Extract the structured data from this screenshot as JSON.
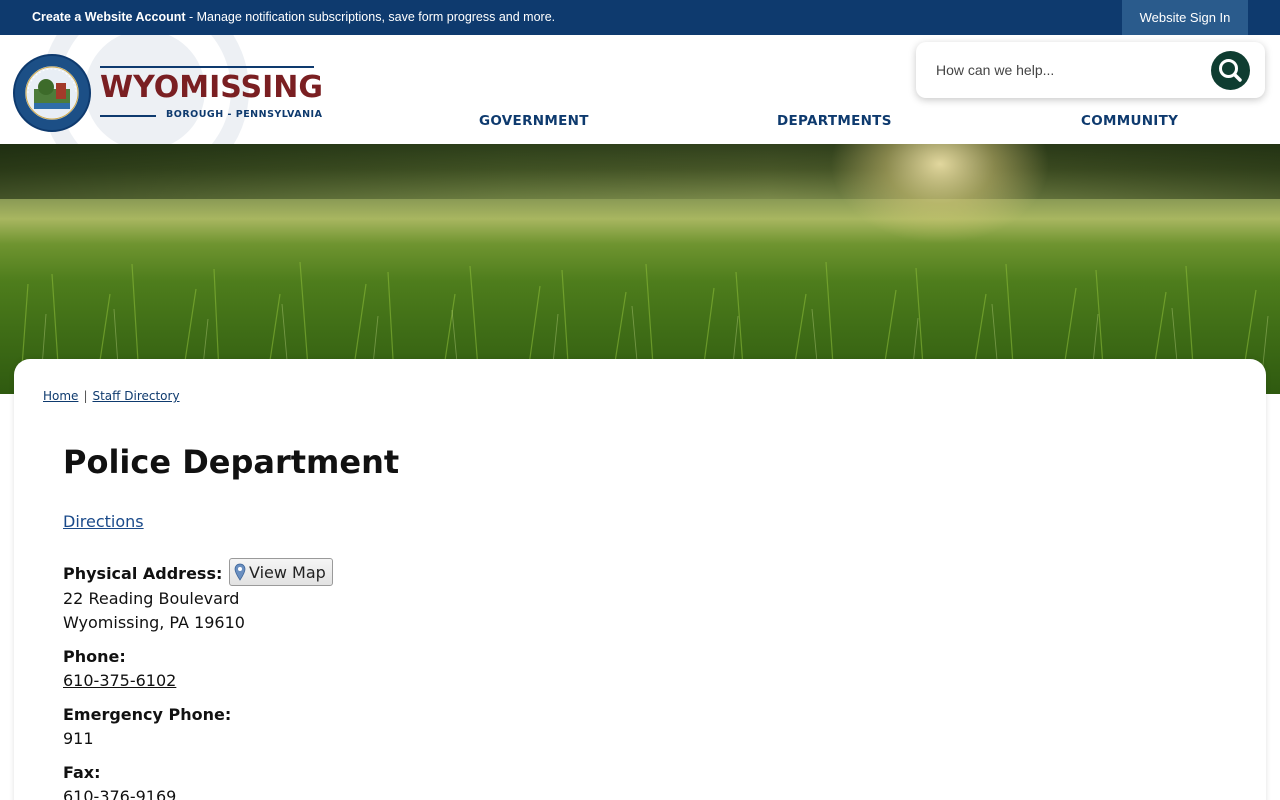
{
  "topbar": {
    "account_link": "Create a Website Account",
    "account_desc": " - Manage notification subscriptions, save form progress and more.",
    "sign_in": "Website Sign In"
  },
  "header": {
    "logo_name": "WYOMISSING",
    "logo_sub": "BOROUGH - PENNSYLVANIA",
    "search_placeholder": "How can we help...",
    "nav": [
      "GOVERNMENT",
      "DEPARTMENTS",
      "COMMUNITY"
    ]
  },
  "breadcrumb": {
    "home": "Home",
    "sep": "|",
    "staff": "Staff Directory"
  },
  "page": {
    "title": "Police Department",
    "directions": "Directions",
    "physical_label": "Physical Address:",
    "view_map": "View Map",
    "address_line1": "22 Reading Boulevard",
    "address_line2": "Wyomissing, PA 19610",
    "phone_label": "Phone:",
    "phone": "610-375-6102",
    "emergency_label": "Emergency Phone:",
    "emergency": "911",
    "fax_label": "Fax:",
    "fax": "610-376-9169"
  },
  "colors": {
    "topbar": "#0e3a6e",
    "brand_red": "#7a1f22",
    "search_button": "#0f3d31"
  }
}
